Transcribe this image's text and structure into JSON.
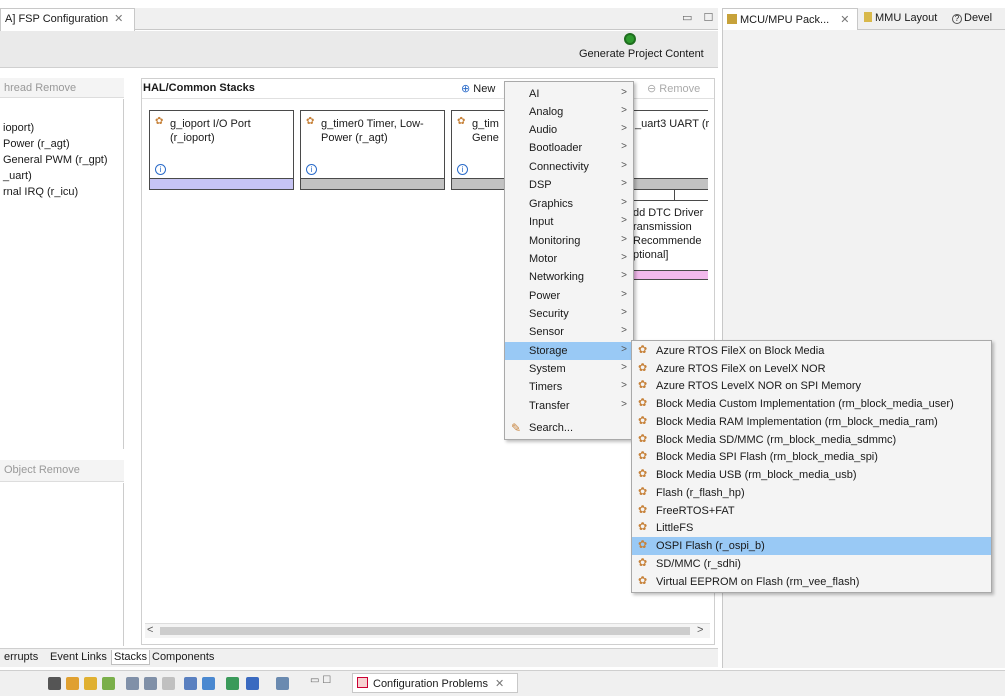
{
  "editor_tab": {
    "title": "A] FSP Configuration",
    "close": "✕"
  },
  "window_controls": "▭ ☐",
  "right_tabs": [
    {
      "title": "MCU/MPU Pack...",
      "close": "✕"
    },
    {
      "title": "MMU Layout"
    },
    {
      "title": "Devel"
    }
  ],
  "header": {
    "generate_label": "Generate Project Content"
  },
  "threads_panel": {
    "toolbar": "hread  Remove",
    "items": [
      "ioport)",
      "Power (r_agt)",
      "General PWM (r_gpt)",
      "_uart)",
      "rnal IRQ (r_icu)"
    ]
  },
  "objects_panel": {
    "toolbar": "Object  Remove"
  },
  "hal_panel": {
    "title": "HAL/Common Stacks",
    "new_label": "New",
    "remove_label": "Remove",
    "stacks": [
      {
        "label": "g_ioport I/O Port (r_ioport)"
      },
      {
        "label": "g_timer0 Timer, Low-Power (r_agt)"
      },
      {
        "label": "g_tim Gene"
      },
      {
        "label": "_uart3 UART (r"
      }
    ],
    "dtc_label": "dd DTC Driver ransmission Recommende ptional]"
  },
  "scroll": {
    "left": "<",
    "right": ">"
  },
  "bottom_tabs": [
    "errupts",
    "Event Links",
    "Stacks",
    "Components"
  ],
  "config_problems": {
    "title": "Configuration Problems",
    "close": "✕"
  },
  "menu": {
    "items": [
      {
        "label": "AI",
        "arrow": ">"
      },
      {
        "label": "Analog",
        "arrow": ">"
      },
      {
        "label": "Audio",
        "arrow": ">"
      },
      {
        "label": "Bootloader",
        "arrow": ">"
      },
      {
        "label": "Connectivity",
        "arrow": ">"
      },
      {
        "label": "DSP",
        "arrow": ">"
      },
      {
        "label": "Graphics",
        "arrow": ">"
      },
      {
        "label": "Input",
        "arrow": ">"
      },
      {
        "label": "Monitoring",
        "arrow": ">"
      },
      {
        "label": "Motor",
        "arrow": ">"
      },
      {
        "label": "Networking",
        "arrow": ">"
      },
      {
        "label": "Power",
        "arrow": ">"
      },
      {
        "label": "Security",
        "arrow": ">"
      },
      {
        "label": "Sensor",
        "arrow": ">"
      },
      {
        "label": "Storage",
        "arrow": ">"
      },
      {
        "label": "System",
        "arrow": ">"
      },
      {
        "label": "Timers",
        "arrow": ">"
      },
      {
        "label": "Transfer",
        "arrow": ">"
      }
    ],
    "search_label": "Search...",
    "selected": "Storage"
  },
  "submenu": {
    "items": [
      "Azure RTOS FileX on Block Media",
      "Azure RTOS FileX on LevelX NOR",
      "Azure RTOS LevelX NOR on SPI Memory",
      "Block Media Custom Implementation (rm_block_media_user)",
      "Block Media RAM Implementation (rm_block_media_ram)",
      "Block Media SD/MMC (rm_block_media_sdmmc)",
      "Block Media SPI Flash (rm_block_media_spi)",
      "Block Media USB (rm_block_media_usb)",
      "Flash (r_flash_hp)",
      "FreeRTOS+FAT",
      "LittleFS",
      "OSPI Flash (r_ospi_b)",
      "SD/MMC (r_sdhi)",
      "Virtual EEPROM on Flash (rm_vee_flash)"
    ],
    "selected": "OSPI Flash (r_ospi_b)"
  },
  "colors": {
    "highlight": "#99c9f5",
    "ioport_bar": "#c6c4f4",
    "dtc_bar": "#f2b9ec",
    "icon_orange": "#c7823a"
  },
  "icons": [
    "gear-icon",
    "info-icon",
    "generate-icon",
    "search-icon",
    "chevron-right-icon",
    "close-icon"
  ]
}
